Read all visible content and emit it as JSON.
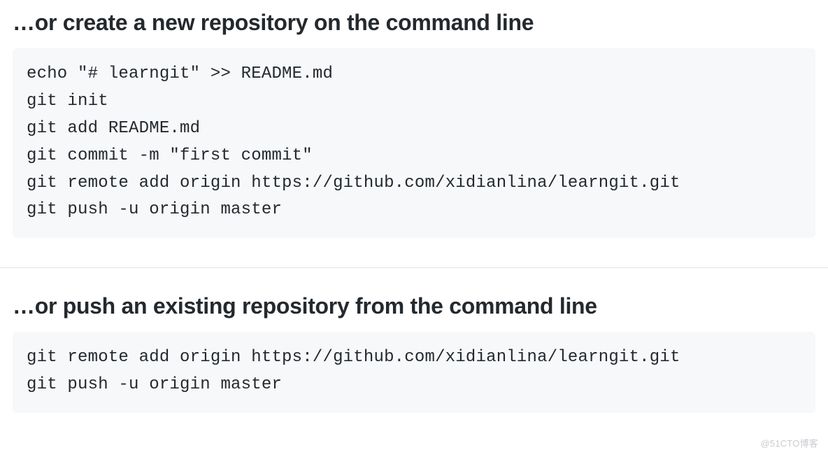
{
  "sections": [
    {
      "heading": "…or create a new repository on the command line",
      "code": "echo \"# learngit\" >> README.md\ngit init\ngit add README.md\ngit commit -m \"first commit\"\ngit remote add origin https://github.com/xidianlina/learngit.git\ngit push -u origin master"
    },
    {
      "heading": "…or push an existing repository from the command line",
      "code": "git remote add origin https://github.com/xidianlina/learngit.git\ngit push -u origin master"
    }
  ],
  "watermark": "@51CTO博客"
}
